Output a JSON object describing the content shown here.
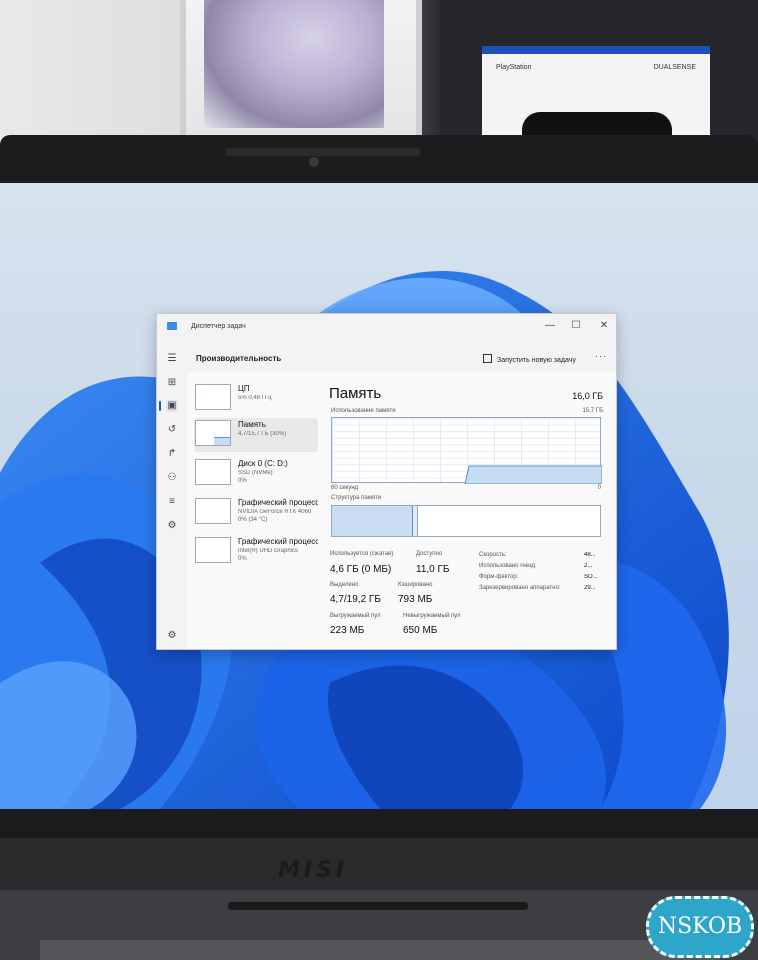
{
  "background": {
    "ps_box_label_left": "PlayStation",
    "ps_box_label_right": "DUALSENSE"
  },
  "laptop": {
    "brand_logo": "MISI"
  },
  "watermark": "NSKOB",
  "window": {
    "title": "Диспетчер задач",
    "minimize": "—",
    "maximize": "☐",
    "close": "✕"
  },
  "header": {
    "section_title": "Производительность",
    "run_task_label": "Запустить новую задачу",
    "more_label": "···"
  },
  "nav_icons": [
    "menu-icon",
    "processes-icon",
    "performance-icon",
    "app-history-icon",
    "startup-icon",
    "users-icon",
    "details-icon",
    "services-icon",
    "settings-icon"
  ],
  "devices": [
    {
      "name": "ЦП",
      "sub1": "5% 0,48 ГГц",
      "sub2": ""
    },
    {
      "name": "Память",
      "sub1": "4,7/15,7 ГБ (30%)",
      "sub2": ""
    },
    {
      "name": "Диск 0 (C: D:)",
      "sub1": "SSD (NVMe)",
      "sub2": "0%"
    },
    {
      "name": "Графический процессор 0",
      "sub1": "NVIDIA GeForce RTX 4060",
      "sub2": "0% (34 °C)"
    },
    {
      "name": "Графический процессор 1",
      "sub1": "Intel(R) UHD Graphics",
      "sub2": "0%"
    }
  ],
  "memory": {
    "title": "Память",
    "total": "16,0 ГБ",
    "usage_label": "Использование памяти",
    "usage_max": "15,7 ГБ",
    "axis_left": "60 секунд",
    "axis_right": "0",
    "structure_label": "Структура памяти",
    "usage_fraction": 0.3,
    "structure_used_fraction": 0.3,
    "structure_modified_fraction": 0.015,
    "stats": {
      "in_use_label": "Используется (сжатая)",
      "in_use_value": "4,6 ГБ (0 МБ)",
      "available_label": "Доступно",
      "available_value": "11,0 ГБ",
      "committed_label": "Выделено",
      "committed_value": "4,7/19,2 ГБ",
      "cached_label": "Кэшировано",
      "cached_value": "793 МБ",
      "paged_label": "Выгружаемый пул",
      "paged_value": "223 МБ",
      "nonpaged_label": "Невыгружаемый пул",
      "nonpaged_value": "650 МБ"
    },
    "details": [
      {
        "key": "Скорость:",
        "value": "48..."
      },
      {
        "key": "Использовано гнезд:",
        "value": "2..."
      },
      {
        "key": "Форм-фактор:",
        "value": "SO..."
      },
      {
        "key": "Зарезервировано аппаратно:",
        "value": "29..."
      }
    ]
  },
  "colors": {
    "accent": "#0063b1",
    "graph_fill": "#c7dcf3",
    "graph_line": "#5a8fcf"
  }
}
